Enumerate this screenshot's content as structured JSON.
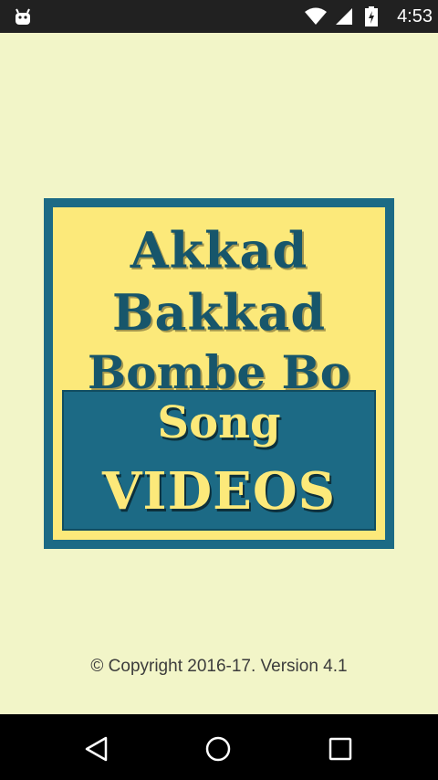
{
  "status_bar": {
    "time": "4:53",
    "icons": [
      "android-icon",
      "wifi-icon",
      "signal-icon",
      "battery-icon"
    ]
  },
  "splash": {
    "logo_lines": [
      "Akkad",
      "Bakkad",
      "Bombe Bo",
      "Song",
      "VIDEOS"
    ],
    "colors": {
      "background": "#f2f5c8",
      "logo_yellow": "#fce97a",
      "logo_teal": "#1c6a85"
    }
  },
  "footer": {
    "copyright": "© Copyright 2016-17. Version 4.1"
  },
  "nav_bar": {
    "buttons": [
      "back-icon",
      "home-icon",
      "recents-icon"
    ]
  }
}
